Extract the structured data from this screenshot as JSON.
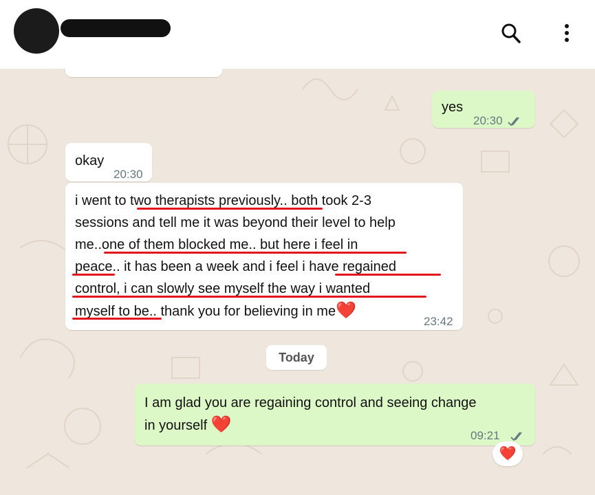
{
  "header": {
    "contact_name": "",
    "icons": {
      "search": "search-icon",
      "menu": "more-vertical-icon"
    }
  },
  "messages": [
    {
      "direction": "outgoing",
      "text": "yes",
      "time": "20:30",
      "status": "double-check-icon"
    },
    {
      "direction": "incoming",
      "text": "okay",
      "time": "20:30"
    },
    {
      "direction": "incoming",
      "text": "i went to two therapists previously.. both took 2-3\nsessions and tell me it was beyond their level to help\nme..one of them blocked me.. but here i feel in\npeace.. it has been a week and i feel i have regained\ncontrol, i can slowly see myself the way i wanted\nmyself to be.. thank you for believing in me",
      "emoji": "❤️",
      "time": "23:42"
    },
    {
      "direction": "outgoing",
      "text": "I am glad you are regaining control and seeing change\nin yourself",
      "emoji": "❤️",
      "time": "09:21",
      "status": "double-check-icon",
      "reaction": "❤️"
    }
  ],
  "date_divider": "Today",
  "colors": {
    "chat_background": "#efe7dd",
    "outgoing_bubble": "#dcf8c6",
    "incoming_bubble": "#ffffff",
    "annotation_underline": "#e3131f"
  }
}
